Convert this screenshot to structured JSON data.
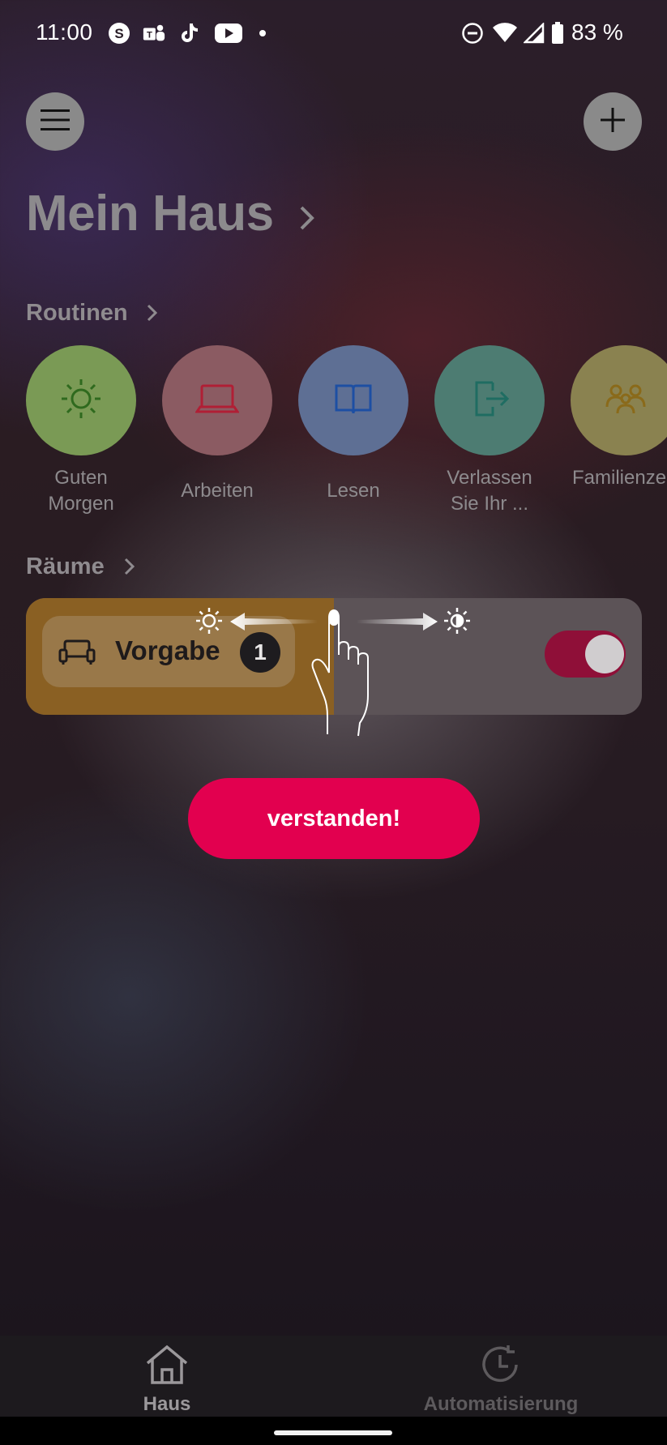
{
  "status_bar": {
    "time": "11:00",
    "battery": "83 %",
    "app_icons": [
      "skype-icon",
      "teams-icon",
      "tiktok-icon",
      "youtube-icon"
    ],
    "system_icons": [
      "do-not-disturb-icon",
      "wifi-icon",
      "signal-icon",
      "battery-icon"
    ]
  },
  "header": {
    "title": "Mein Haus"
  },
  "routines": {
    "title": "Routinen",
    "items": [
      {
        "label": "Guten Morgen",
        "icon": "sun-icon",
        "bg": "#7a9a55",
        "color": "#2f6a1e"
      },
      {
        "label": "Arbeiten",
        "icon": "laptop-icon",
        "bg": "#8b5b62",
        "color": "#b01f35"
      },
      {
        "label": "Lesen",
        "icon": "book-icon",
        "bg": "#5e6f94",
        "color": "#1d4fa3"
      },
      {
        "label": "Verlassen Sie Ihr ...",
        "icon": "exit-icon",
        "bg": "#4d7c72",
        "color": "#1f6d62"
      },
      {
        "label": "Familienzeit",
        "icon": "family-icon",
        "bg": "#8a8250",
        "color": "#8a6a1a"
      }
    ]
  },
  "rooms": {
    "title": "Räume",
    "card": {
      "name": "Vorgabe",
      "badge": "1",
      "brightness_level": 0.5,
      "power_on": true
    }
  },
  "confirm_button": "verstanden!",
  "bottom_nav": {
    "items": [
      {
        "label": "Haus",
        "icon": "home-icon",
        "active": true
      },
      {
        "label": "Automatisierung",
        "icon": "automation-clock-icon",
        "active": false
      }
    ]
  },
  "colors": {
    "accent": "#e2004f",
    "toggle_on": "#8f0f38",
    "room_fill": "#8a6023"
  }
}
